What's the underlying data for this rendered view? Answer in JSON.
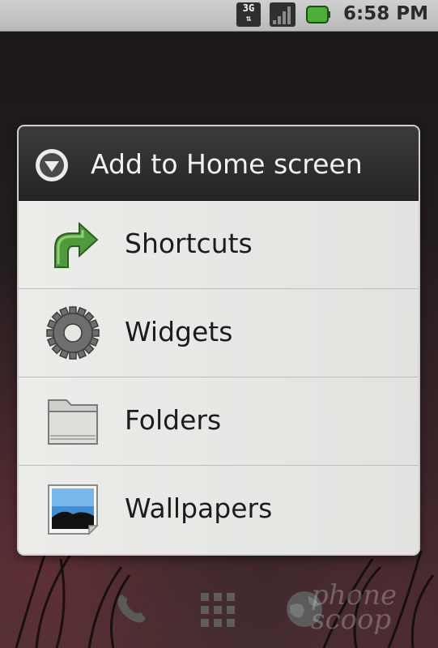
{
  "status_bar": {
    "network_label": "3G",
    "time": "6:58 PM",
    "battery_color": "#4caf3a"
  },
  "dialog": {
    "title": "Add to Home screen",
    "title_icon": "chevron-down-circle-icon",
    "items": [
      {
        "label": "Shortcuts",
        "icon": "shortcut-arrow-icon"
      },
      {
        "label": "Widgets",
        "icon": "gear-icon"
      },
      {
        "label": "Folders",
        "icon": "folder-icon"
      },
      {
        "label": "Wallpapers",
        "icon": "wallpaper-icon"
      }
    ]
  },
  "dock": {
    "items": [
      "phone-icon",
      "app-drawer-icon",
      "browser-icon"
    ]
  },
  "watermark": "phone scoop"
}
